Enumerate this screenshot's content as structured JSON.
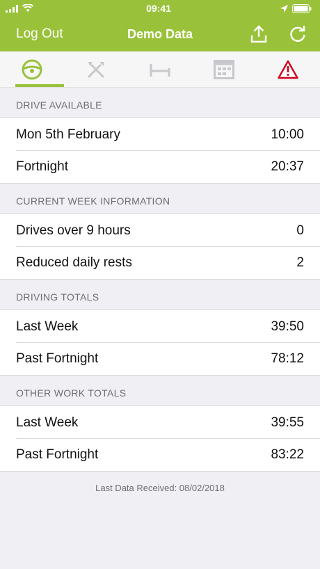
{
  "status_bar": {
    "time": "09:41"
  },
  "nav": {
    "left_label": "Log Out",
    "title": "Demo Data"
  },
  "tabs": [
    {
      "name": "steering-wheel-icon",
      "active": true
    },
    {
      "name": "tools-icon",
      "active": false
    },
    {
      "name": "bed-icon",
      "active": false
    },
    {
      "name": "calendar-icon",
      "active": false
    },
    {
      "name": "warning-icon",
      "active": false
    }
  ],
  "colors": {
    "accent": "#99c23a",
    "warning": "#d0021b",
    "inactive_icon": "#c7c7cc"
  },
  "sections": [
    {
      "header": "DRIVE AVAILABLE",
      "rows": [
        {
          "label": "Mon 5th February",
          "value": "10:00"
        },
        {
          "label": "Fortnight",
          "value": "20:37"
        }
      ]
    },
    {
      "header": "CURRENT WEEK INFORMATION",
      "rows": [
        {
          "label": "Drives over 9 hours",
          "value": "0"
        },
        {
          "label": "Reduced daily rests",
          "value": "2"
        }
      ]
    },
    {
      "header": "DRIVING TOTALS",
      "rows": [
        {
          "label": "Last Week",
          "value": "39:50"
        },
        {
          "label": "Past Fortnight",
          "value": "78:12"
        }
      ]
    },
    {
      "header": "OTHER WORK TOTALS",
      "rows": [
        {
          "label": "Last Week",
          "value": "39:55"
        },
        {
          "label": "Past Fortnight",
          "value": "83:22"
        }
      ]
    }
  ],
  "footer": "Last Data Received: 08/02/2018"
}
